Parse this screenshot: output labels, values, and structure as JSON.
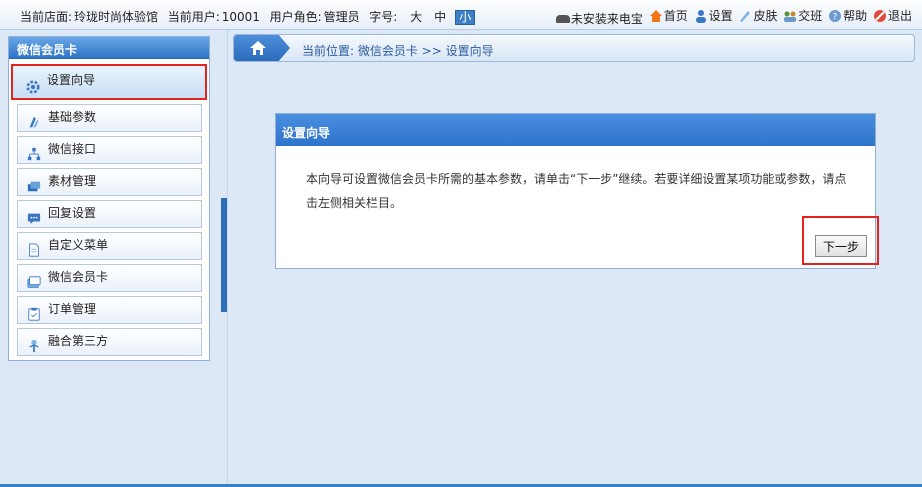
{
  "topbar": {
    "store_label": "当前店面:",
    "store_value": "玲珑时尚体验馆",
    "user_label": "当前用户:",
    "user_value": "10001",
    "role_label": "用户角色:",
    "role_value": "管理员",
    "font_label": "字号:",
    "font_sizes": [
      "大",
      "中",
      "小"
    ],
    "links": [
      "未安装来电宝",
      "首页",
      "设置",
      "皮肤",
      "交班",
      "帮助",
      "退出"
    ]
  },
  "sidebar": {
    "title": "微信会员卡",
    "items": [
      {
        "label": "设置向导",
        "icon": "gear-icon"
      },
      {
        "label": "基础参数",
        "icon": "params-icon"
      },
      {
        "label": "微信接口",
        "icon": "network-icon"
      },
      {
        "label": "素材管理",
        "icon": "material-icon"
      },
      {
        "label": "回复设置",
        "icon": "chat-icon"
      },
      {
        "label": "自定义菜单",
        "icon": "document-icon"
      },
      {
        "label": "微信会员卡",
        "icon": "card-icon"
      },
      {
        "label": "订单管理",
        "icon": "clipboard-icon"
      },
      {
        "label": "融合第三方",
        "icon": "tree-icon"
      }
    ]
  },
  "breadcrumb": {
    "text": "当前位置: 微信会员卡 >> 设置向导"
  },
  "dialog": {
    "title": "设置向导",
    "body": "本向导可设置微信会员卡所需的基本参数，请单击“下一步”继续。若要详细设置某项功能或参数，请点击左侧相关栏目。",
    "next_label": "下一步"
  },
  "colors": {
    "accent": "#2f76c8",
    "highlight": "#e5221b",
    "background": "#dce8f5"
  }
}
